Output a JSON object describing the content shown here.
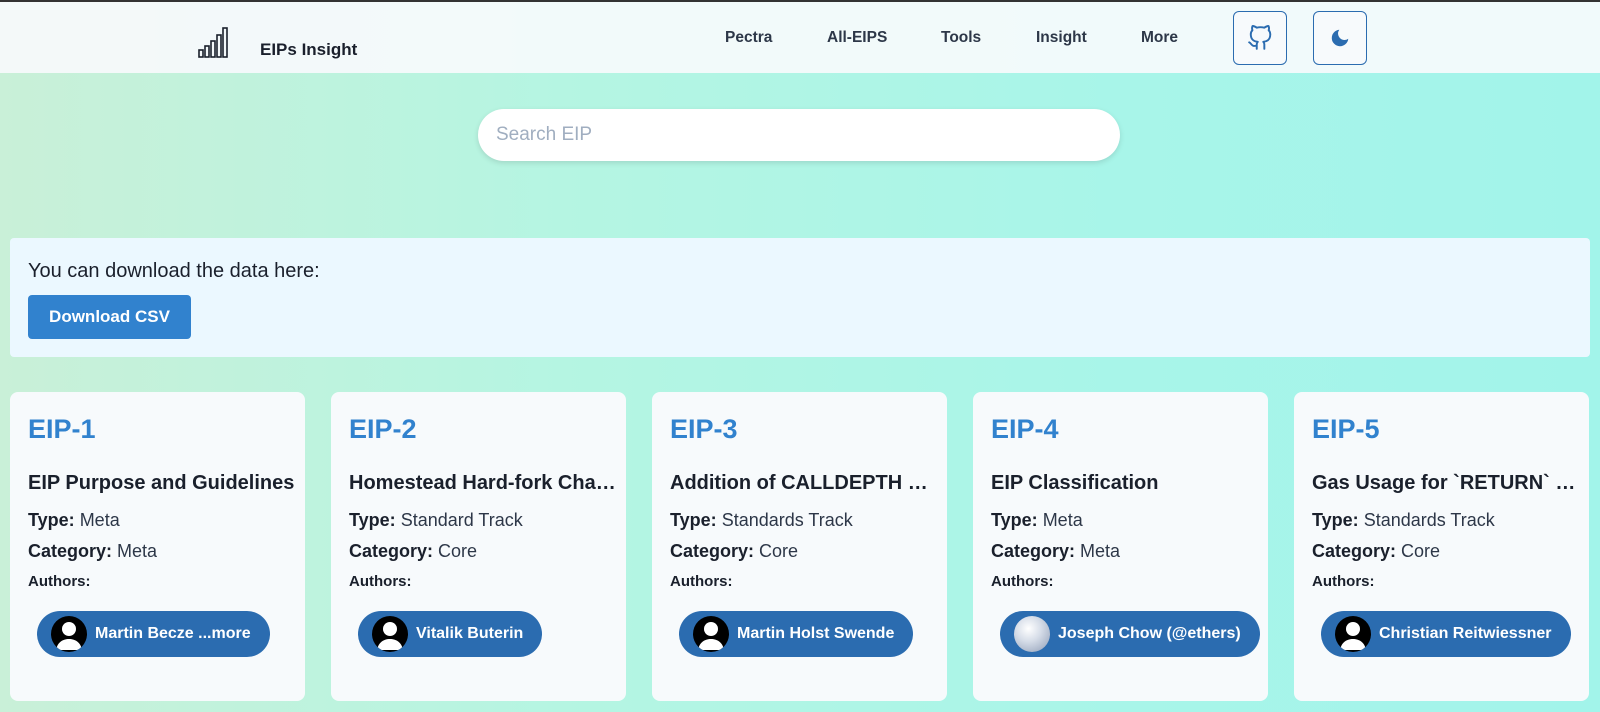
{
  "header": {
    "brand": "EIPs Insight",
    "nav": [
      "Pectra",
      "All-EIPS",
      "Tools",
      "Insight",
      "More"
    ],
    "icons": {
      "github": "github-icon",
      "theme": "moon-icon"
    }
  },
  "search": {
    "placeholder": "Search EIP",
    "value": ""
  },
  "download": {
    "text": "You can download the data here:",
    "button_label": "Download CSV"
  },
  "labels": {
    "type": "Type:",
    "category": "Category:",
    "authors": "Authors:"
  },
  "cards": [
    {
      "number": "EIP-1",
      "title": "EIP Purpose and Guidelines",
      "type": "Meta",
      "category": "Meta",
      "author": "Martin Becze ...more",
      "avatar": "user-silhouette"
    },
    {
      "number": "EIP-2",
      "title": "Homestead Hard-fork Changes",
      "type": "Standard Track",
      "category": "Core",
      "author": "Vitalik Buterin",
      "avatar": "user-silhouette"
    },
    {
      "number": "EIP-3",
      "title": "Addition of CALLDEPTH opcode",
      "type": "Standards Track",
      "category": "Core",
      "author": "Martin Holst Swende",
      "avatar": "user-silhouette"
    },
    {
      "number": "EIP-4",
      "title": "EIP Classification",
      "type": "Meta",
      "category": "Meta",
      "author": "Joseph Chow (@ethers)",
      "avatar": "profile-photo"
    },
    {
      "number": "EIP-5",
      "title": "Gas Usage for `RETURN` and `CALL*`",
      "type": "Standards Track",
      "category": "Core",
      "author": "Christian Reitwiessner",
      "avatar": "user-silhouette"
    }
  ],
  "colors": {
    "accent": "#3182ce",
    "pill": "#2b6cb0",
    "card_bg": "#f7fafc",
    "download_bg": "#ebf8ff"
  }
}
